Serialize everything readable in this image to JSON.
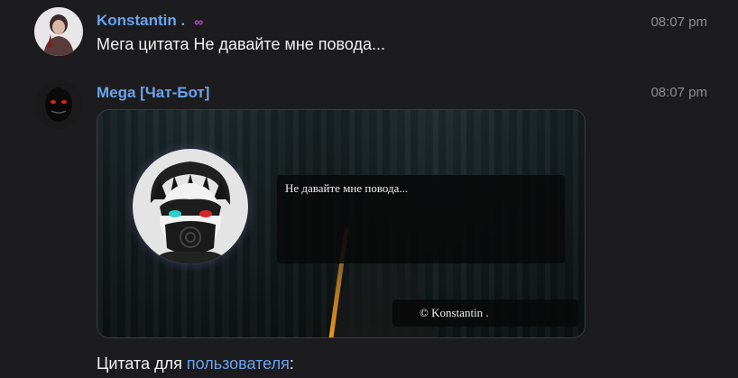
{
  "messages": [
    {
      "author": "Konstantin .",
      "badge_icon": "infinity-icon",
      "time": "08:07 pm",
      "text": "Мега цитата Не давайте мне повода..."
    },
    {
      "author": "Mega [Чат-Бот]",
      "time": "08:07 pm",
      "card": {
        "quote": "Не давайте мне повода...",
        "signature": "© Konstantin ."
      },
      "footer_text": "Цитата для ",
      "footer_link": "пользователя",
      "footer_suffix": ":"
    }
  ],
  "colors": {
    "background": "#1c1c1e",
    "author": "#6aa3f0",
    "timestamp": "#8e8e93",
    "badge": "#c040e0",
    "road_line": "#e8961f"
  }
}
